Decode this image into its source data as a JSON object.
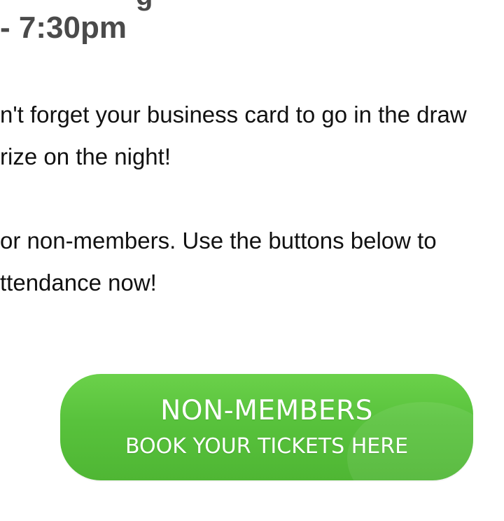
{
  "heading": {
    "cut_fragment": "g",
    "time": "- 7:30pm"
  },
  "paragraphs": [
    {
      "lines": [
        "n't forget your business card to go in the draw",
        "rize on the night!"
      ]
    },
    {
      "lines": [
        "or non-members. Use the buttons below to",
        "ttendance now!"
      ]
    }
  ],
  "cta": {
    "line1": "NON-MEMBERS",
    "line2": "BOOK YOUR TICKETS HERE",
    "color": "#5cc43e"
  }
}
